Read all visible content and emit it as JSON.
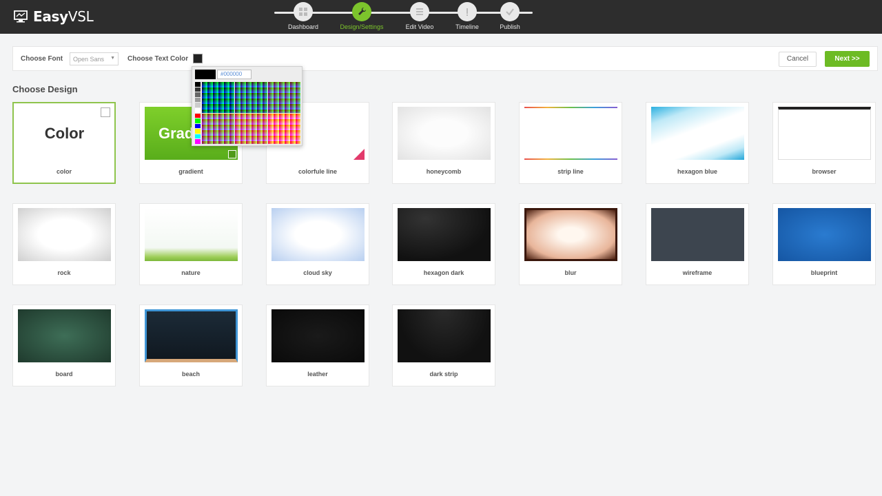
{
  "app": {
    "logo_text_bold": "Easy",
    "logo_text_rest": "VSL"
  },
  "steps": [
    {
      "label": "Dashboard",
      "icon": "grid-icon",
      "active": false
    },
    {
      "label": "Design/Settings",
      "icon": "wrench-icon",
      "active": true
    },
    {
      "label": "Edit Video",
      "icon": "list-icon",
      "active": false
    },
    {
      "label": "Timeline",
      "icon": "clock-icon",
      "active": false
    },
    {
      "label": "Publish",
      "icon": "check-icon",
      "active": false
    }
  ],
  "toolbar": {
    "font_label": "Choose Font",
    "font_value": "Open Sans",
    "color_label": "Choose Text Color",
    "text_color": "#222222",
    "cancel_label": "Cancel",
    "next_label": "Next >>"
  },
  "color_picker": {
    "hex_value": "#000000",
    "current_color": "#000000"
  },
  "section_title": "Choose Design",
  "designs": [
    {
      "label": "color",
      "thumb_text": "Color",
      "selected": true
    },
    {
      "label": "gradient",
      "thumb_text": "Grad",
      "selected": false
    },
    {
      "label": "colorfule line",
      "selected": false
    },
    {
      "label": "honeycomb",
      "selected": false
    },
    {
      "label": "strip line",
      "selected": false
    },
    {
      "label": "hexagon blue",
      "selected": false
    },
    {
      "label": "browser",
      "selected": false
    },
    {
      "label": "rock",
      "selected": false
    },
    {
      "label": "nature",
      "selected": false
    },
    {
      "label": "cloud sky",
      "selected": false
    },
    {
      "label": "hexagon dark",
      "selected": false
    },
    {
      "label": "blur",
      "selected": false
    },
    {
      "label": "wireframe",
      "selected": false
    },
    {
      "label": "blueprint",
      "selected": false
    },
    {
      "label": "board",
      "selected": false
    },
    {
      "label": "beach",
      "selected": false
    },
    {
      "label": "leather",
      "selected": false
    },
    {
      "label": "dark strip",
      "selected": false
    }
  ],
  "colors": {
    "accent": "#7cc42c",
    "header_bg": "#2d2d2d",
    "page_bg": "#f3f4f5"
  }
}
